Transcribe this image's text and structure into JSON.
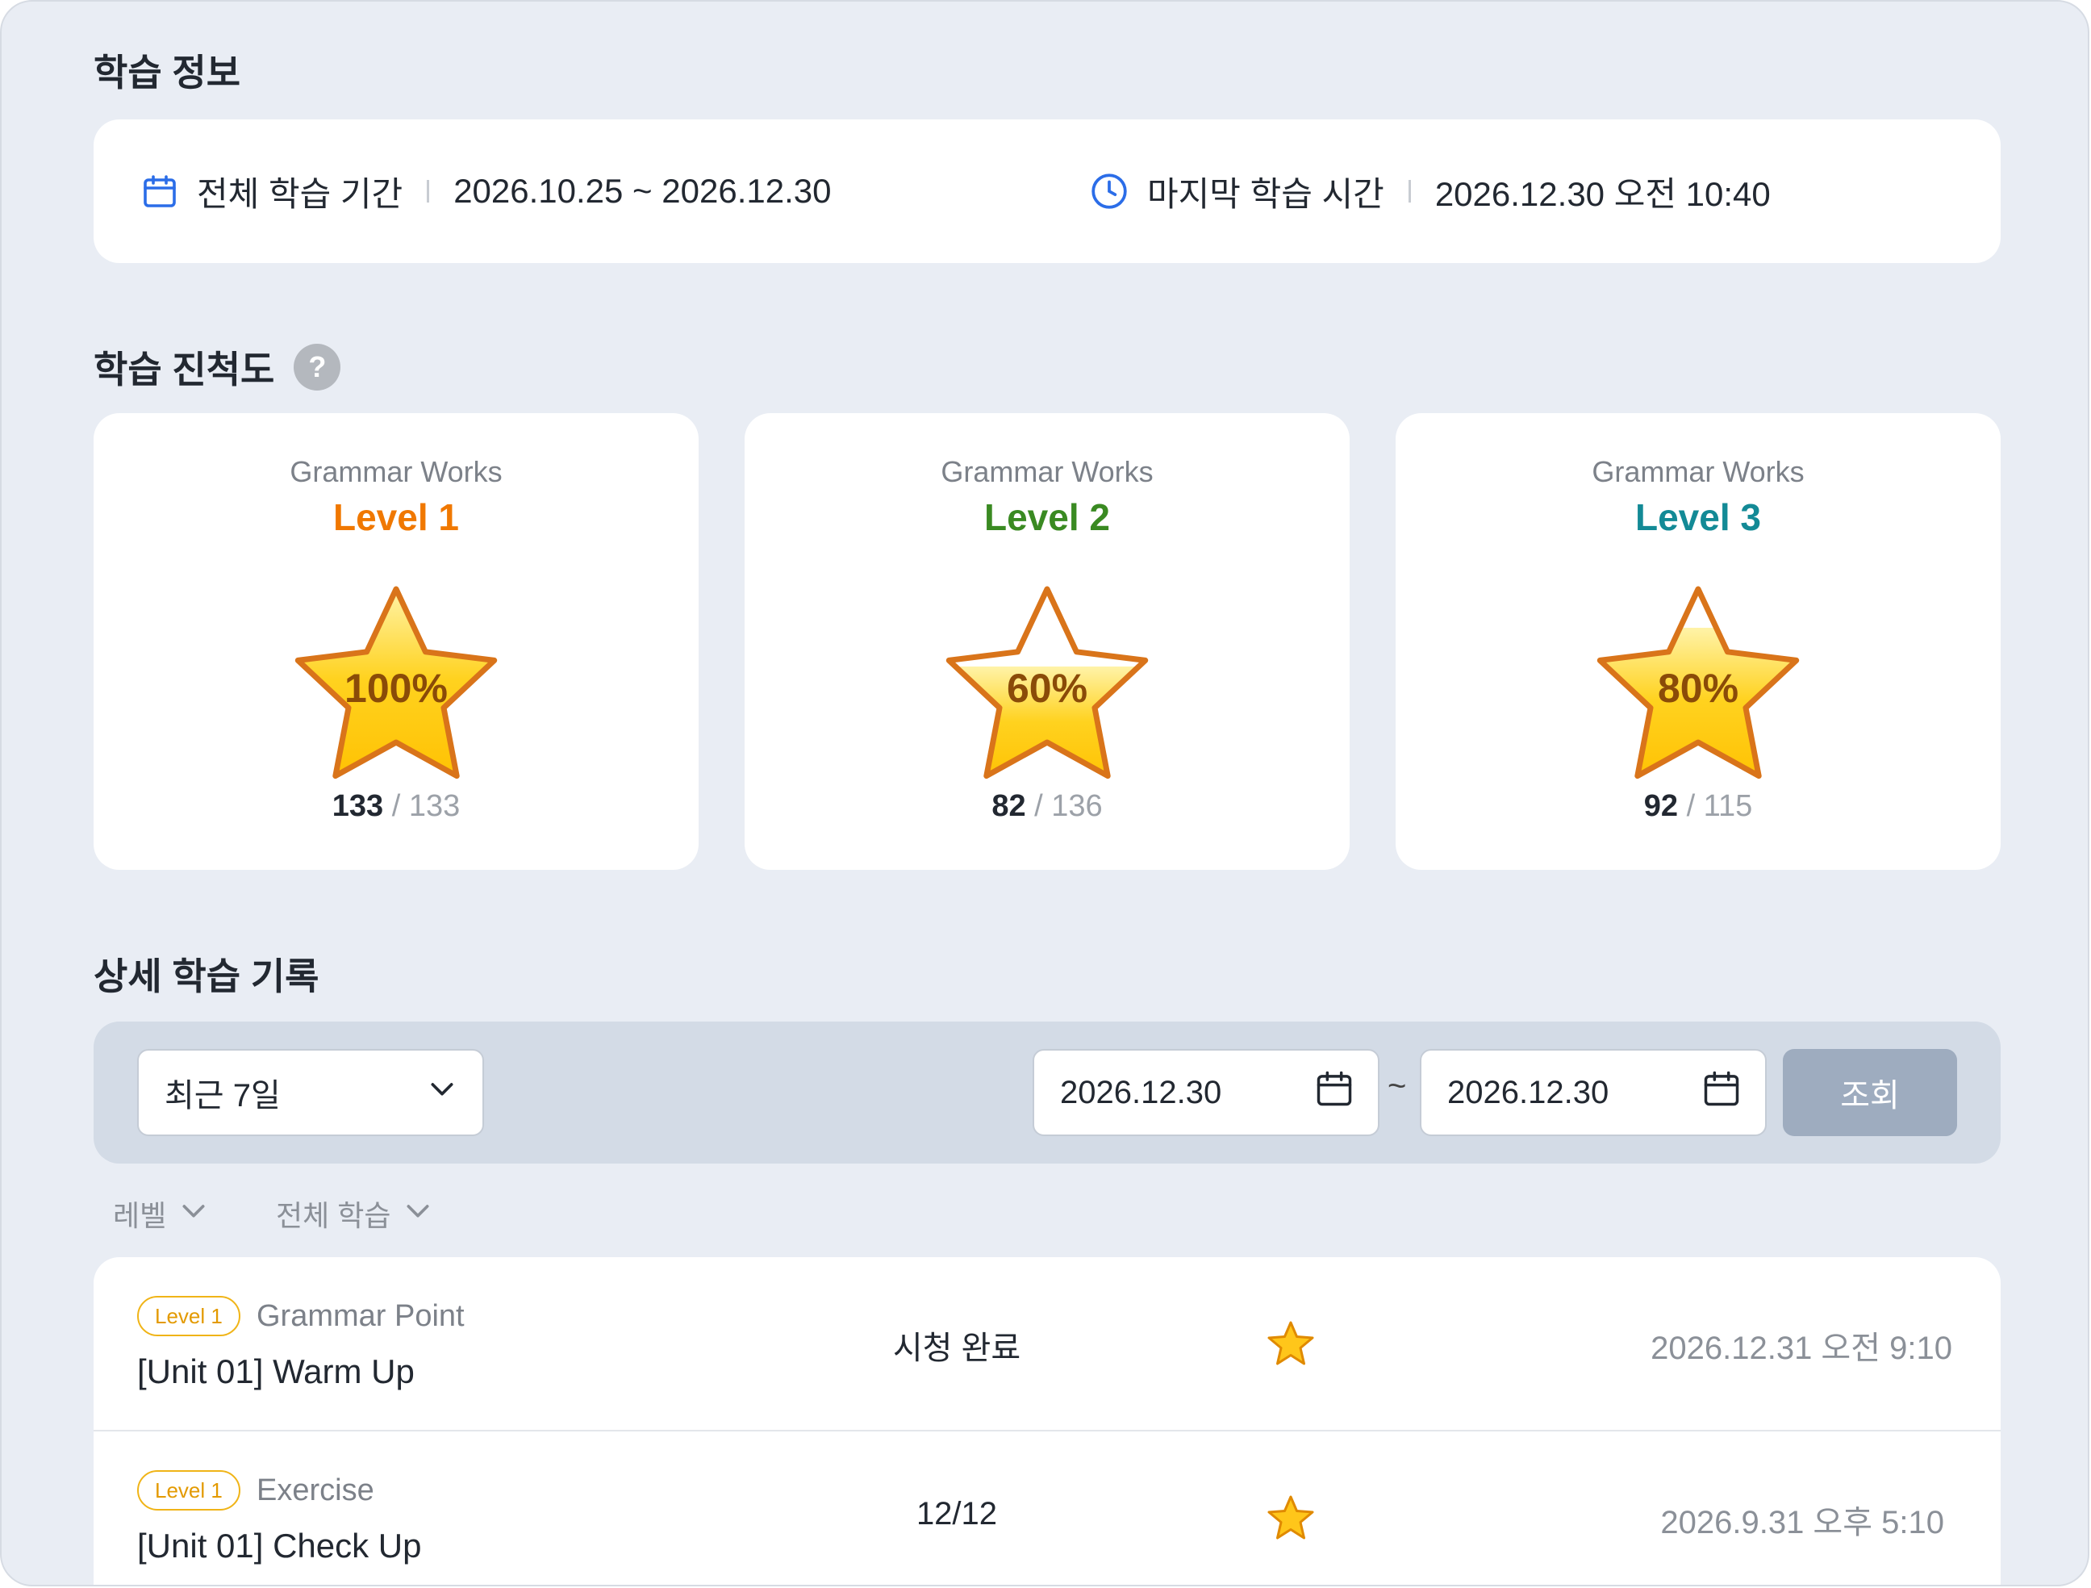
{
  "learning_info": {
    "title": "학습 정보",
    "period_label": "전체 학습 기간",
    "period_value": "2026.10.25 ~ 2026.12.30",
    "last_label": "마지막 학습 시간",
    "last_value": "2026.12.30 오전 10:40",
    "icons": [
      "calendar-icon",
      "clock-icon"
    ],
    "accent_color": "#2b6de8"
  },
  "progress": {
    "title": "학습 진척도",
    "help_glyph": "?",
    "cards": [
      {
        "course": "Grammar Works",
        "level": "Level 1",
        "level_color": "#f07800",
        "percent": "100%",
        "fill": 1.0,
        "done": "133",
        "total": "/ 133"
      },
      {
        "course": "Grammar Works",
        "level": "Level 2",
        "level_color": "#3a8a22",
        "percent": "60%",
        "fill": 0.6,
        "done": "82",
        "total": "/ 136"
      },
      {
        "course": "Grammar Works",
        "level": "Level 3",
        "level_color": "#138a96",
        "percent": "80%",
        "fill": 0.8,
        "done": "92",
        "total": "/ 115"
      }
    ]
  },
  "records": {
    "title": "상세 학습 기록",
    "period_select": "최근 7일",
    "date_from": "2026.12.30",
    "date_to": "2026.12.30",
    "date_sep": "~",
    "search_label": "조회",
    "filter_level": "레벨",
    "filter_type": "전체 학습",
    "items": [
      {
        "badge": "Level 1",
        "category": "Grammar Point",
        "title": "[Unit 01] Warm Up",
        "status": "시청 완료",
        "date": "2026.12.31 오전 9:10"
      },
      {
        "badge": "Level 1",
        "category": "Exercise",
        "title": "[Unit 01] Check Up",
        "status": "12/12",
        "date": "2026.9.31 오후 5:10"
      }
    ]
  }
}
